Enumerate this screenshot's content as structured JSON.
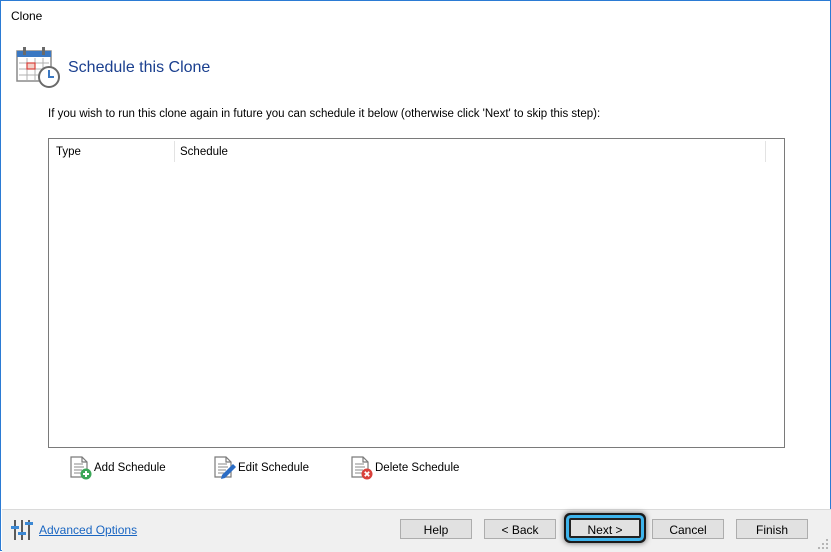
{
  "window": {
    "title": "Clone"
  },
  "header": {
    "icon": "calendar-clock-icon",
    "title": "Schedule this Clone"
  },
  "intro_text": "If you wish to run this clone again in future you can schedule it below (otherwise click 'Next' to skip this step):",
  "schedule_list": {
    "columns": [
      "Type",
      "Schedule"
    ],
    "rows": []
  },
  "actions": {
    "add": {
      "label": "Add Schedule",
      "icon": "document-add-icon"
    },
    "edit": {
      "label": "Edit Schedule",
      "icon": "document-edit-icon"
    },
    "delete": {
      "label": "Delete Schedule",
      "icon": "document-delete-icon"
    }
  },
  "footer": {
    "advanced_options": {
      "label": "Advanced Options",
      "icon": "sliders-icon"
    },
    "buttons": {
      "help": "Help",
      "back": "< Back",
      "next": "Next >",
      "cancel": "Cancel",
      "finish": "Finish"
    }
  },
  "colors": {
    "accent_blue": "#2b7bd4",
    "title_blue": "#1a3f8f",
    "link_blue": "#1a66c2",
    "highlight_cyan": "#3db4ec",
    "add_green": "#3aa757",
    "delete_red": "#d9413b"
  }
}
